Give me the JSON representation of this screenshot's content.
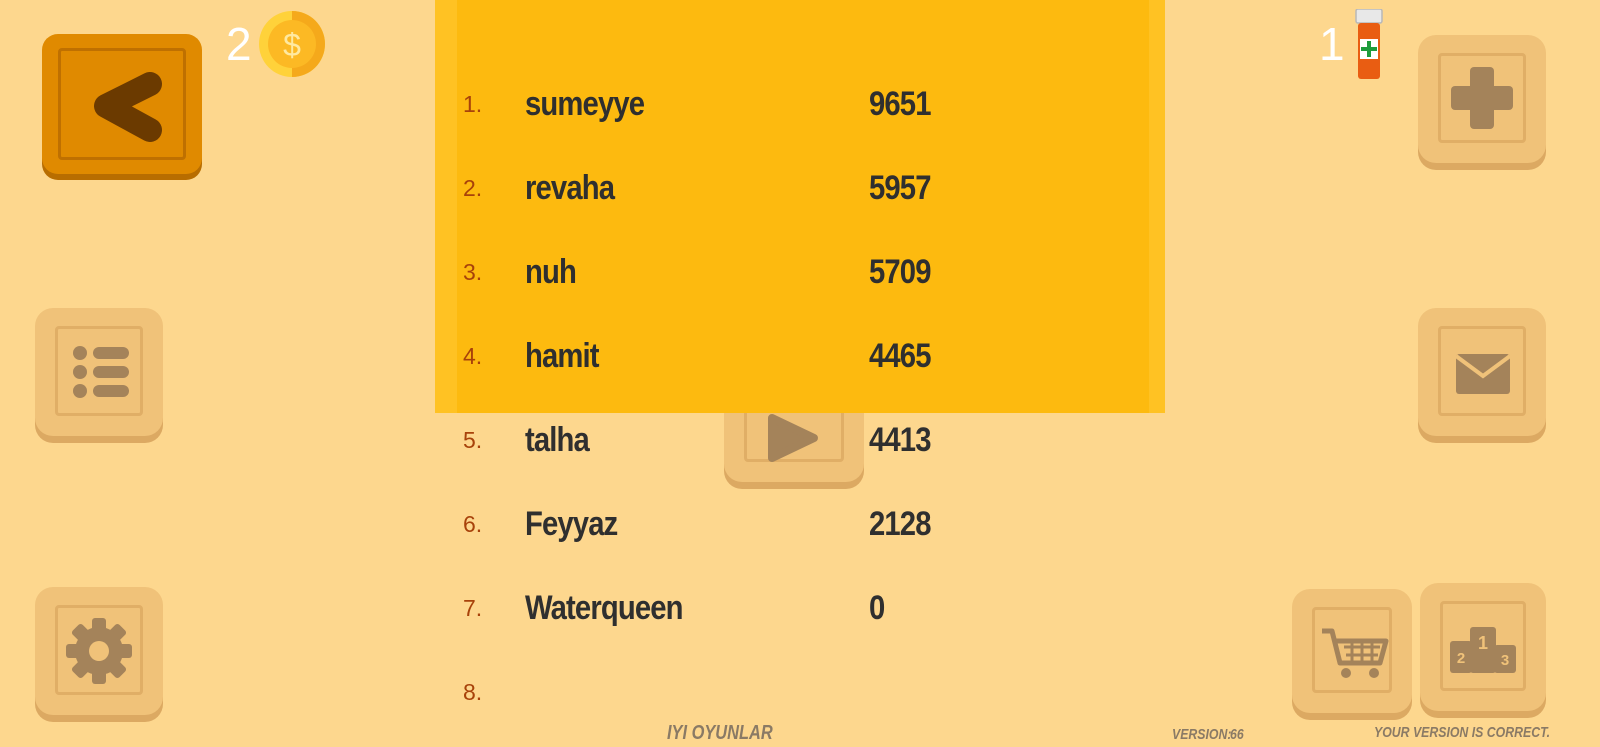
{
  "hud": {
    "coins": "2",
    "coin_icon": "dollar-coin-icon",
    "potions": "1",
    "potion_icon": "medicine-bottle-icon"
  },
  "buttons": {
    "back": "back-arrow-icon",
    "add": "plus-icon",
    "list": "list-icon",
    "mail": "mail-icon",
    "play": "play-icon",
    "settings": "gear-icon",
    "shop": "cart-icon",
    "leaderboard": "podium-icon"
  },
  "leaderboard": {
    "rows": [
      {
        "rank": "1.",
        "name": "sumeyye",
        "score": "9651"
      },
      {
        "rank": "2.",
        "name": "revaha",
        "score": "5957"
      },
      {
        "rank": "3.",
        "name": "nuh",
        "score": "5709"
      },
      {
        "rank": "4.",
        "name": "hamit",
        "score": "4465"
      },
      {
        "rank": "5.",
        "name": "talha",
        "score": "4413"
      },
      {
        "rank": "6.",
        "name": "Feyyaz",
        "score": "2128"
      },
      {
        "rank": "7.",
        "name": "Waterqueen",
        "score": "0"
      },
      {
        "rank": "8.",
        "name": "",
        "score": ""
      }
    ]
  },
  "footer": {
    "title": "IYI OYUNLAR",
    "version_label": "VERSION:",
    "version_number": "66",
    "status": "YOUR VERSION IS CORRECT."
  },
  "colors": {
    "background": "#fdd78e",
    "panel": "#fdba0f",
    "back_button": "#e08a00",
    "rank_text": "#a8420a",
    "name_text": "#2f2f2f"
  }
}
